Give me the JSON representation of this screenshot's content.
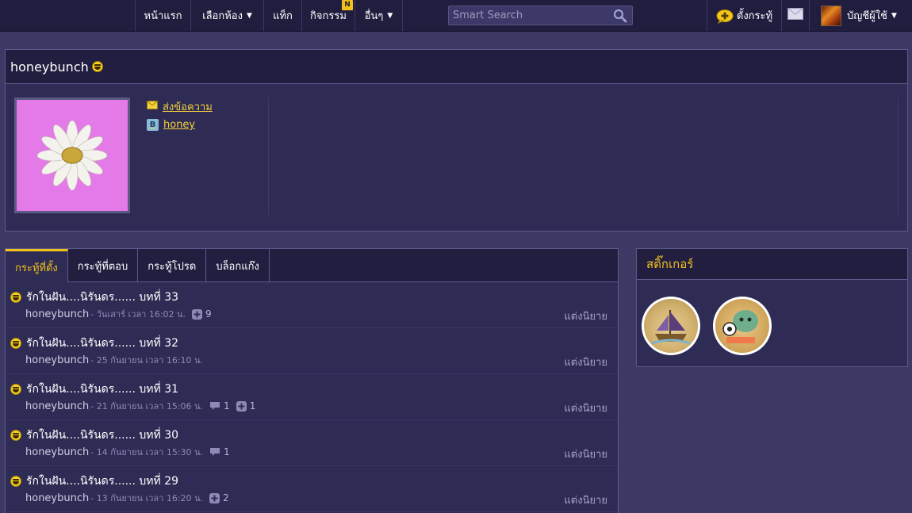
{
  "nav": {
    "home": "หน้าแรก",
    "rooms": "เลือกห้อง",
    "tags": "แท็ก",
    "activities": "กิจกรรม",
    "activities_badge": "N",
    "others": "อื่นๆ",
    "search_placeholder": "Smart Search",
    "new_topic": "ตั้งกระทู้",
    "account": "บัญชีผู้ใช้"
  },
  "profile": {
    "username": "honeybunch",
    "send_message": "ส่งข้อความ",
    "blog": "honey"
  },
  "tabs": [
    {
      "label": "กระทู้ที่ตั้ง",
      "active": true
    },
    {
      "label": "กระทู้ที่ตอบ",
      "active": false
    },
    {
      "label": "กระทู้โปรด",
      "active": false
    },
    {
      "label": "บล็อกแก๊ง",
      "active": false
    }
  ],
  "topics": [
    {
      "title": "รักในฝัน....นิรันดร...... บทที่ 33",
      "author": "honeybunch",
      "time": "- วันเสาร์ เวลา 16:02 น.",
      "comments": "",
      "plus": "9",
      "tag": "แต่งนิยาย"
    },
    {
      "title": "รักในฝัน....นิรันดร...... บทที่ 32",
      "author": "honeybunch",
      "time": "- 25 กันยายน เวลา 16:10 น.",
      "comments": "",
      "plus": "",
      "tag": "แต่งนิยาย"
    },
    {
      "title": "รักในฝัน....นิรันดร...... บทที่ 31",
      "author": "honeybunch",
      "time": "- 21 กันยายน เวลา 15:06 น.",
      "comments": "1",
      "plus": "1",
      "tag": "แต่งนิยาย"
    },
    {
      "title": "รักในฝัน....นิรันดร...... บทที่ 30",
      "author": "honeybunch",
      "time": "- 14 กันยายน เวลา 15:30 น.",
      "comments": "1",
      "plus": "",
      "tag": "แต่งนิยาย"
    },
    {
      "title": "รักในฝัน....นิรันดร...... บทที่ 29",
      "author": "honeybunch",
      "time": "- 13 กันยายน เวลา 16:20 น.",
      "comments": "",
      "plus": "2",
      "tag": "แต่งนิยาย"
    }
  ],
  "stickers": {
    "title": "สติ๊กเกอร์"
  }
}
